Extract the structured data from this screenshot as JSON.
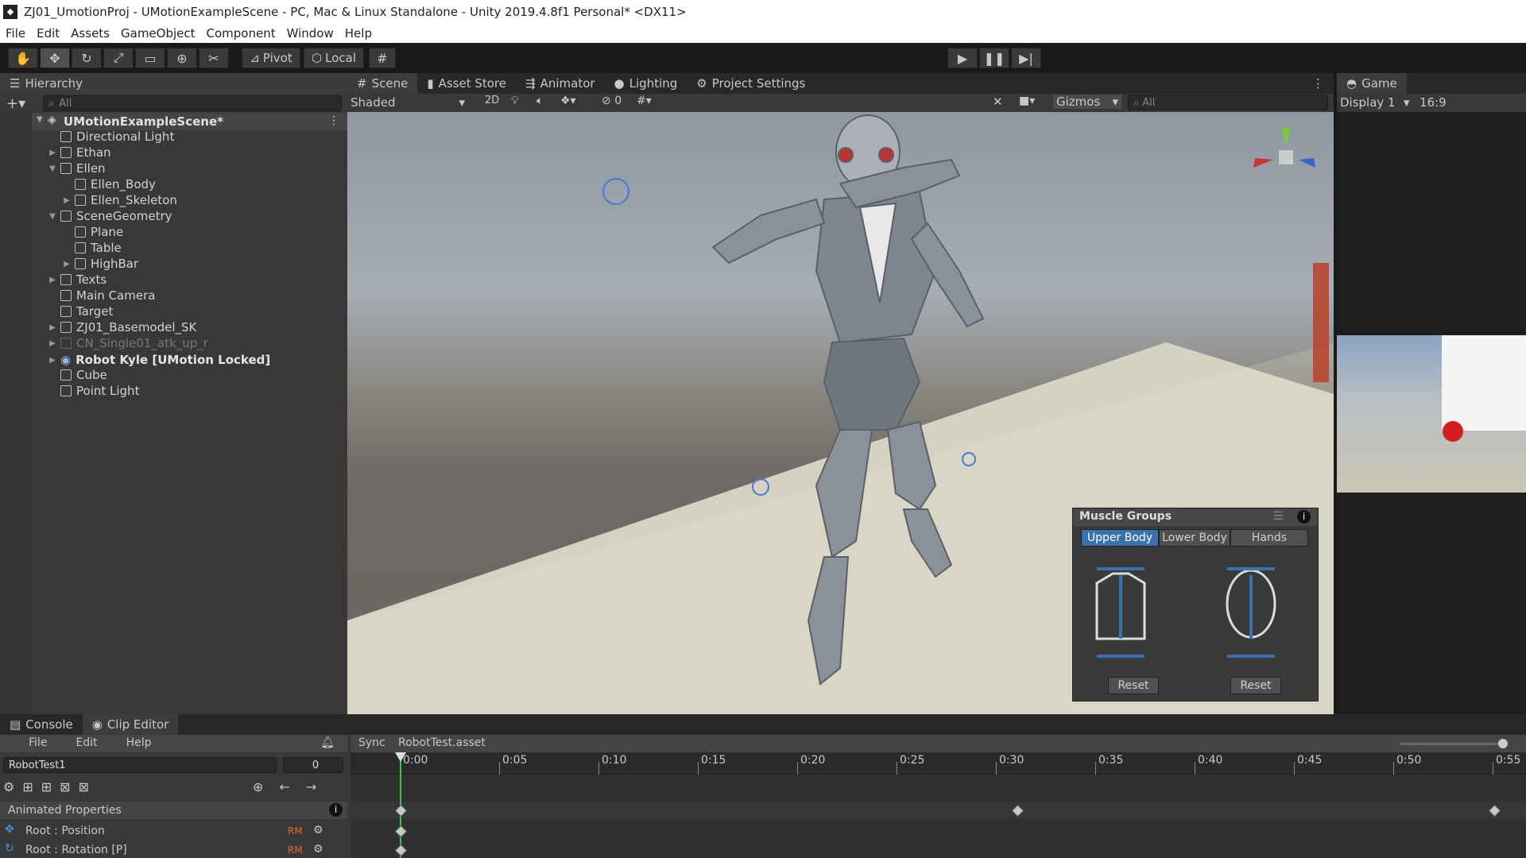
{
  "window": {
    "title": "ZJ01_UmotionProj - UMotionExampleScene - PC, Mac & Linux Standalone - Unity 2019.4.8f1 Personal* <DX11>"
  },
  "menu": [
    "File",
    "Edit",
    "Assets",
    "GameObject",
    "Component",
    "Window",
    "Help"
  ],
  "toolbar": {
    "pivot": "Pivot",
    "local": "Local"
  },
  "hierarchy": {
    "tab": "Hierarchy",
    "search_placeholder": "All",
    "scene_name": "UMotionExampleScene*",
    "items": [
      {
        "label": "Directional Light"
      },
      {
        "label": "Ethan"
      },
      {
        "label": "Ellen"
      },
      {
        "label": "Ellen_Body"
      },
      {
        "label": "Ellen_Skeleton"
      },
      {
        "label": "SceneGeometry"
      },
      {
        "label": "Plane"
      },
      {
        "label": "Table"
      },
      {
        "label": "HighBar"
      },
      {
        "label": "Texts"
      },
      {
        "label": "Main Camera"
      },
      {
        "label": "Target"
      },
      {
        "label": "ZJ01_Basemodel_SK"
      },
      {
        "label": "CN_Single01_atk_up_r"
      },
      {
        "label": "Robot Kyle [UMotion Locked]"
      },
      {
        "label": "Cube"
      },
      {
        "label": "Point Light"
      }
    ]
  },
  "scene_tabs": [
    "Scene",
    "Asset Store",
    "Animator",
    "Lighting",
    "Project Settings"
  ],
  "scene_toolbar": {
    "shading": "Shaded",
    "mode_2d": "2D",
    "hidden_count": "0",
    "gizmos": "Gizmos",
    "search_placeholder": "All"
  },
  "game": {
    "tab": "Game",
    "display": "Display 1",
    "aspect": "16:9"
  },
  "muscle_groups": {
    "title": "Muscle Groups",
    "tabs": [
      "Upper Body",
      "Lower Body",
      "Hands"
    ],
    "reset_left": "Reset",
    "reset_right": "Reset"
  },
  "bottom_tabs": [
    "Console",
    "Clip Editor"
  ],
  "clip_editor": {
    "menu": [
      "File",
      "Edit",
      "Help"
    ],
    "sync": "Sync",
    "asset": "RobotTest.asset",
    "clip": "RobotTest1",
    "frame": "0",
    "animated_properties": "Animated Properties",
    "properties": [
      {
        "label": "Root : Position",
        "badge": "RM"
      },
      {
        "label": "Root : Rotation [P]",
        "badge": "RM"
      }
    ],
    "time_labels": [
      "0:00",
      "0:05",
      "0:10",
      "0:15",
      "0:20",
      "0:25",
      "0:30",
      "0:35",
      "0:40",
      "0:45",
      "0:50",
      "0:55"
    ]
  },
  "colors": {
    "selection_blue": "#3a72b0",
    "playhead_green": "#2ecc40",
    "badge_orange": "#e07020"
  }
}
